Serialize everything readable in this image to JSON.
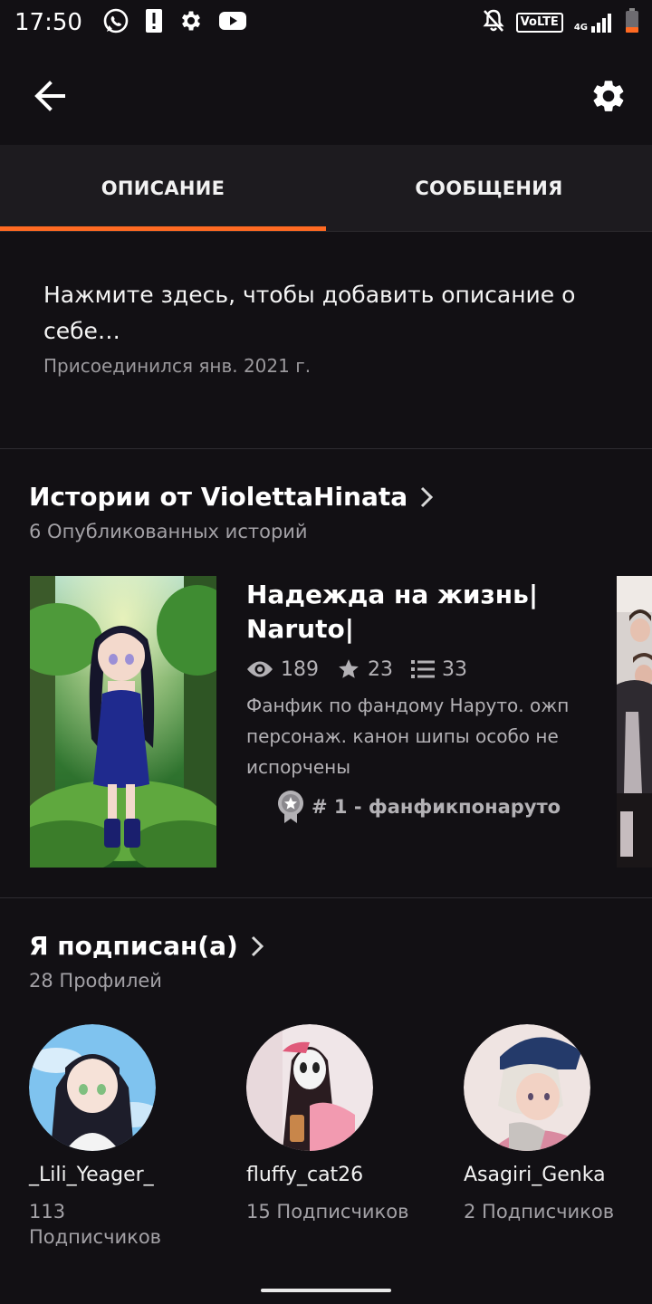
{
  "status_bar": {
    "time": "17:50",
    "volte": "VoLTE",
    "network": "4G",
    "icons": [
      "whatsapp-icon",
      "alert-icon",
      "gear-icon",
      "youtube-icon",
      "bell-off-icon",
      "signal-icon",
      "battery-icon"
    ]
  },
  "app_bar": {
    "back_icon": "arrow-left-icon",
    "settings_icon": "gear-icon"
  },
  "tabs": [
    {
      "label": "ОПИСАНИЕ",
      "active": true
    },
    {
      "label": "СООБЩЕНИЯ",
      "active": false
    }
  ],
  "accent_color": "#ff6a22",
  "about": {
    "description_placeholder": "Нажмите здесь, чтобы добавить описание о себе…",
    "joined": "Присоединился янв. 2021 г."
  },
  "stories": {
    "title": "Истории от ViolettaHinata",
    "count_label": "6 Опубликованных историй",
    "items": [
      {
        "title": "Надежда на жизнь| Naruto|",
        "views": "189",
        "votes": "23",
        "parts": "33",
        "description": "Фанфик по фандому Наруто. ожп персонаж. канон шипы особо не испорчены",
        "rank": "# 1 - фанфикпонаруто"
      }
    ]
  },
  "following": {
    "title": "Я подписан(а)",
    "count_label": "28 Профилей",
    "profiles": [
      {
        "name": "_Lili_Yeager_",
        "followers": "113 Подписчиков"
      },
      {
        "name": "fluffy_cat26",
        "followers": "15 Подписчиков"
      },
      {
        "name": "Asagiri_Genka",
        "followers": "2 Подписчиков"
      }
    ]
  }
}
